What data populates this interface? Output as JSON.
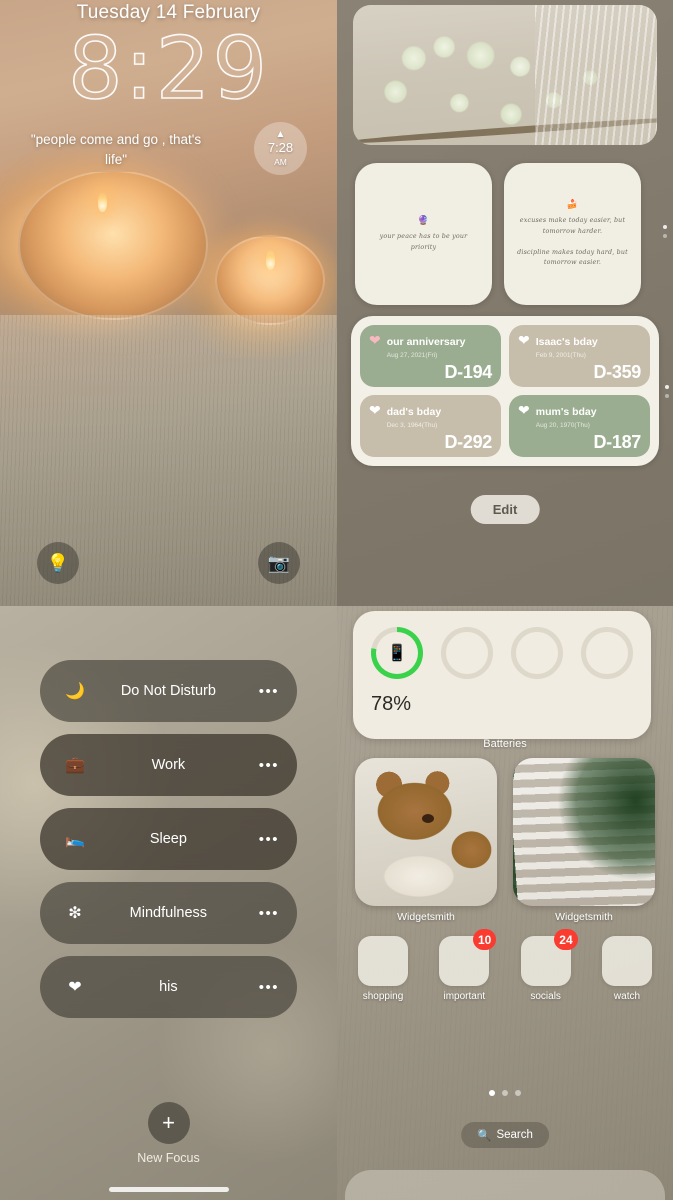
{
  "lock_screen": {
    "date": "Tuesday 14 February",
    "time": "8:29",
    "quote": "\"people come and go , that's life\"",
    "alarm_widget": {
      "icon": "sunrise-icon",
      "time": "7:28",
      "meridiem": "AM"
    },
    "flashlight_icon": "flashlight-icon",
    "camera_icon": "camera-icon"
  },
  "widgets_page": {
    "photo_widget": {
      "name": "flowers-photo-widget"
    },
    "quote_widgets": [
      {
        "emoji": "🔮",
        "lines": [
          "your peace has to be your priority"
        ]
      },
      {
        "emoji": "🍰",
        "lines": [
          "excuses make today easier, but tomorrow harder.",
          "discipline makes today hard, but tomorrow easier."
        ]
      }
    ],
    "countdowns": [
      {
        "title": "our anniversary",
        "date": "Aug 27, 2021(Fri)",
        "days": "D-194",
        "color": "green",
        "heart": "pink"
      },
      {
        "title": "Isaac's bday",
        "date": "Feb 9, 2001(Thu)",
        "days": "D-359",
        "color": "beige",
        "heart": "white"
      },
      {
        "title": "dad's bday",
        "date": "Dec 3, 1964(Thu)",
        "days": "D-292",
        "color": "beige",
        "heart": "white"
      },
      {
        "title": "mum's bday",
        "date": "Aug 20, 1970(Thu)",
        "days": "D-187",
        "color": "green",
        "heart": "white"
      }
    ],
    "edit_label": "Edit"
  },
  "focus_panel": {
    "items": [
      {
        "label": "Do Not Disturb",
        "icon": "moon-icon",
        "more": "•••"
      },
      {
        "label": "Work",
        "icon": "briefcase-icon",
        "more": "•••"
      },
      {
        "label": "Sleep",
        "icon": "bed-icon",
        "more": "•••"
      },
      {
        "label": "Mindfulness",
        "icon": "flower-icon",
        "more": "•••"
      },
      {
        "label": "his",
        "icon": "heart-icon",
        "more": "•••"
      }
    ],
    "new_focus_label": "New Focus",
    "new_focus_icon": "plus-icon"
  },
  "home_screen": {
    "battery_widget": {
      "percent_label": "78%",
      "percent_value": 78,
      "ring_color": "#3ad24a",
      "device_icon": "iphone-icon",
      "empty_slots": 3
    },
    "battery_caption": "Batteries",
    "photo_widgets": [
      {
        "label": "Widgetsmith",
        "image": "teddy-bear-photo"
      },
      {
        "label": "Widgetsmith",
        "image": "palm-plant-photo"
      }
    ],
    "apps": [
      {
        "label": "shopping",
        "badge": ""
      },
      {
        "label": "important",
        "badge": "10"
      },
      {
        "label": "socials",
        "badge": "24"
      },
      {
        "label": "watch",
        "badge": ""
      }
    ],
    "search_label": "Search",
    "search_icon": "search-icon"
  }
}
